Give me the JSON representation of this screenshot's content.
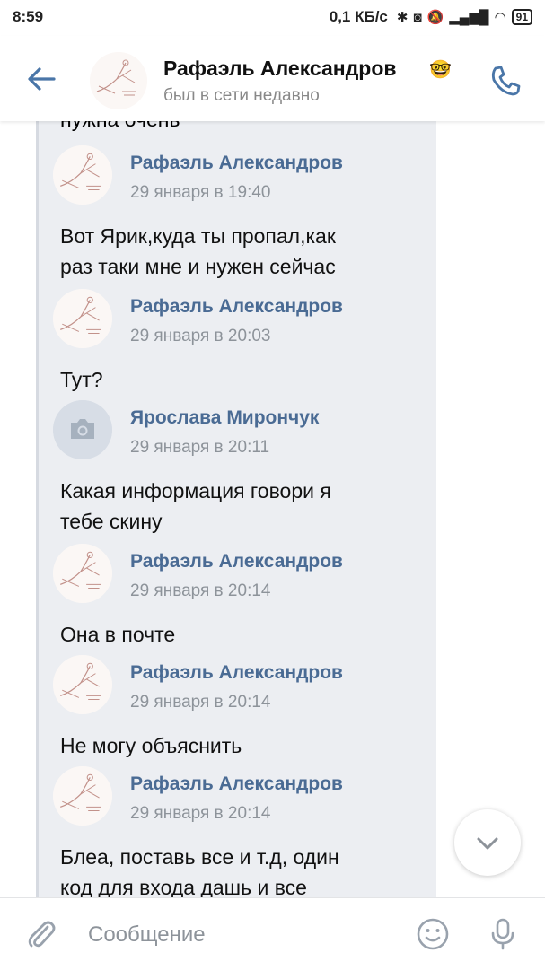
{
  "status_bar": {
    "time": "8:59",
    "network_speed": "0,1 КБ/с",
    "battery": "91"
  },
  "header": {
    "contact_name": "Рафаэль Александров",
    "contact_emoji": "🤓",
    "status": "был в сети недавно",
    "accent_color": "#4a76a8"
  },
  "chat": {
    "cut_top_text": "нужна очень",
    "messages": [
      {
        "name": "Рафаэль Александров",
        "time": "29 января в 19:40",
        "lines": [
          "Вот Ярик,куда ты пропал,как",
          "раз таки мне и нужен сейчас"
        ],
        "avatar": "drawing"
      },
      {
        "name": "Рафаэль Александров",
        "time": "29 января в 20:03",
        "lines": [
          "Тут?"
        ],
        "avatar": "drawing"
      },
      {
        "name": "Ярослава Мирончук",
        "time": "29 января в 20:11",
        "lines": [
          "Какая информация говори я",
          "тебе скину"
        ],
        "avatar": "camera-icon"
      },
      {
        "name": "Рафаэль Александров",
        "time": "29 января в 20:14",
        "lines": [
          "Она в почте"
        ],
        "avatar": "drawing"
      },
      {
        "name": "Рафаэль Александров",
        "time": "29 января в 20:14",
        "lines": [
          "Не могу объяснить"
        ],
        "avatar": "drawing"
      },
      {
        "name": "Рафаэль Александров",
        "time": "29 января в 20:14",
        "lines": [
          "Блеа, поставь все и т.д, один",
          "код для входа дашь и все"
        ],
        "avatar": "drawing"
      }
    ]
  },
  "composer": {
    "placeholder": "Сообщение"
  },
  "icons": {
    "back": "arrow-left-icon",
    "call": "phone-icon",
    "attach": "paperclip-icon",
    "emoji": "smile-icon",
    "mic": "microphone-icon",
    "scroll": "chevron-down-icon"
  }
}
